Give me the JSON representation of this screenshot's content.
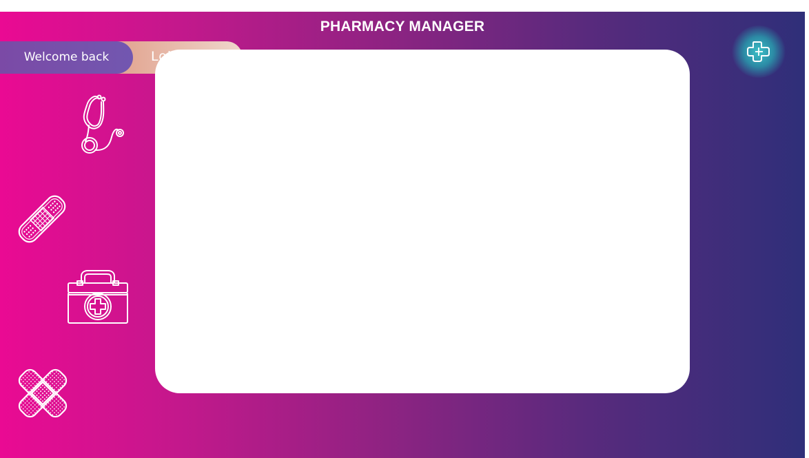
{
  "app": {
    "title": "PHARMACY MANAGER"
  },
  "user": {
    "welcome_label": "Welcome back",
    "name": "Lokesh"
  },
  "sidebar": {
    "items": [
      {
        "icon": "stethoscope-icon"
      },
      {
        "icon": "bandage-icon"
      },
      {
        "icon": "first-aid-kit-icon"
      },
      {
        "icon": "crossed-bandages-icon"
      }
    ]
  },
  "header": {
    "logo_icon": "medical-cross-icon"
  },
  "colors": {
    "gradient_start": "#ea0a93",
    "gradient_end": "#2f2f79",
    "panel": "#ffffff",
    "welcome_pill": "#7257b0",
    "name_pill": "#e3aa97",
    "logo_glow": "#3cc0c7"
  }
}
